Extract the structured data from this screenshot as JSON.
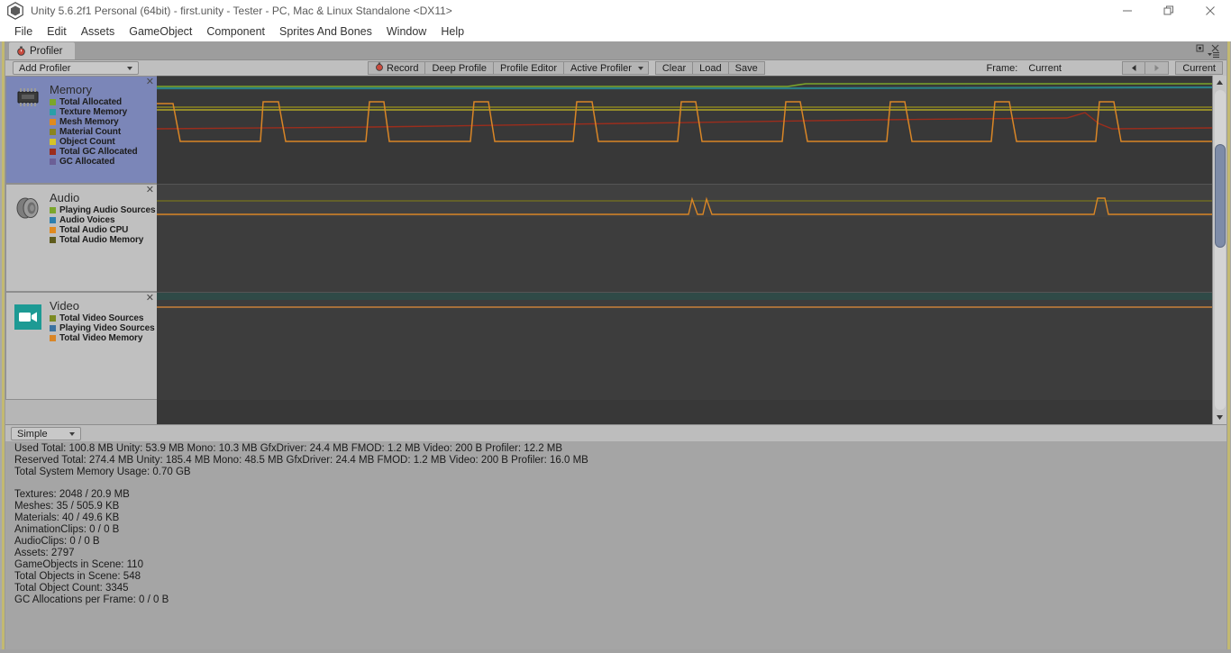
{
  "window": {
    "title": "Unity 5.6.2f1 Personal (64bit) - first.unity - Tester - PC, Mac & Linux Standalone <DX11>",
    "minimize_label": "—",
    "restore_label": "❐",
    "close_label": "✕"
  },
  "menubar": {
    "items": [
      "File",
      "Edit",
      "Assets",
      "GameObject",
      "Component",
      "Sprites And Bones",
      "Window",
      "Help"
    ]
  },
  "panel": {
    "tab_label": "Profiler"
  },
  "toolbar": {
    "add_profiler_label": "Add Profiler",
    "record_label": "Record",
    "deep_profile_label": "Deep Profile",
    "profile_editor_label": "Profile Editor",
    "active_profiler_label": "Active Profiler",
    "clear_label": "Clear",
    "load_label": "Load",
    "save_label": "Save",
    "frame_label": "Frame:",
    "frame_value": "Current",
    "prev_frame_label": "◀",
    "next_frame_label": "▶",
    "current_button_label": "Current"
  },
  "charts": [
    {
      "name": "Memory",
      "icon": "memory-chip-icon",
      "selected": true,
      "close_label": "✕",
      "series": [
        {
          "label": "Total Allocated",
          "color": "#7ba62b"
        },
        {
          "label": "Texture Memory",
          "color": "#2a9fa8"
        },
        {
          "label": "Mesh Memory",
          "color": "#e08a1e"
        },
        {
          "label": "Material Count",
          "color": "#8a8420"
        },
        {
          "label": "Object Count",
          "color": "#d6c327"
        },
        {
          "label": "Total GC Allocated",
          "color": "#9c2d1c"
        },
        {
          "label": "GC Allocated",
          "color": "#6b5f96"
        }
      ]
    },
    {
      "name": "Audio",
      "icon": "speaker-icon",
      "selected": false,
      "close_label": "✕",
      "series": [
        {
          "label": "Playing Audio Sources",
          "color": "#7ba62b"
        },
        {
          "label": "Audio Voices",
          "color": "#2d7fae"
        },
        {
          "label": "Total Audio CPU",
          "color": "#e08a1e"
        },
        {
          "label": "Total Audio Memory",
          "color": "#5e5b1c"
        }
      ]
    },
    {
      "name": "Video",
      "icon": "video-camera-icon",
      "selected": false,
      "close_label": "✕",
      "series": [
        {
          "label": "Total Video Sources",
          "color": "#7c8a22"
        },
        {
          "label": "Playing Video Sources",
          "color": "#3b72a0"
        },
        {
          "label": "Total Video Memory",
          "color": "#d98626"
        }
      ]
    }
  ],
  "viewmode": {
    "selected": "Simple"
  },
  "memory_stats": {
    "used_total": "Used Total: 100.8 MB   Unity: 53.9 MB   Mono: 10.3 MB   GfxDriver: 24.4 MB   FMOD: 1.2 MB   Video: 200 B   Profiler: 12.2 MB",
    "reserved_total": "Reserved Total: 274.4 MB   Unity: 185.4 MB   Mono: 48.5 MB   GfxDriver: 24.4 MB   FMOD: 1.2 MB   Video: 200 B   Profiler: 16.0 MB",
    "system_usage": "Total System Memory Usage: 0.70 GB",
    "details": [
      "Textures: 2048 / 20.9 MB",
      "Meshes: 35 / 505.9 KB",
      "Materials: 40 / 49.6 KB",
      "AnimationClips: 0 / 0 B",
      "AudioClips: 0 / 0 B",
      "Assets: 2797",
      "GameObjects in Scene: 110",
      "Total Objects in Scene: 548",
      "Total Object Count: 3345",
      "GC Allocations per Frame: 0 / 0 B"
    ]
  },
  "chart_data": {
    "type": "line",
    "title": "Unity Profiler - Memory / Audio / Video timelines",
    "xlabel": "Frame",
    "ylabel": "",
    "grid": false,
    "legend_position": "left",
    "panels": [
      {
        "name": "Memory",
        "series": [
          {
            "name": "Total Allocated",
            "color": "#7ba62b",
            "shape": "flat-top-line",
            "level": 0.92
          },
          {
            "name": "Texture Memory",
            "color": "#2a9fa8",
            "shape": "flat-line",
            "level": 0.9
          },
          {
            "name": "Mesh Memory",
            "color": "#e08a1e",
            "shape": "square-pulse",
            "low": 0.42,
            "high": 0.8,
            "pulses": 9
          },
          {
            "name": "Material Count",
            "color": "#8a8420",
            "shape": "flat-line",
            "level": 0.74
          },
          {
            "name": "Object Count",
            "color": "#d6c327",
            "shape": "flat-line",
            "level": 0.73
          },
          {
            "name": "Total GC Allocated",
            "color": "#9c2d1c",
            "shape": "slow-rise",
            "level": 0.6
          },
          {
            "name": "GC Allocated",
            "color": "#6b5f96",
            "shape": "flat-line",
            "level": 0.05
          }
        ]
      },
      {
        "name": "Audio",
        "series": [
          {
            "name": "Total Audio Memory",
            "color": "#8a8420",
            "shape": "flat-line",
            "level": 0.6
          },
          {
            "name": "Total Audio CPU",
            "color": "#e08a1e",
            "shape": "spike-line",
            "base": 0.25,
            "peak": 0.62,
            "spikes": 3
          }
        ]
      },
      {
        "name": "Video",
        "series": [
          {
            "name": "Playing Video Sources",
            "color": "#31504f",
            "shape": "band-top",
            "level": 0.96
          },
          {
            "name": "Total Video Memory",
            "color": "#d98626",
            "shape": "flat-line",
            "level": 0.78
          }
        ]
      }
    ]
  }
}
